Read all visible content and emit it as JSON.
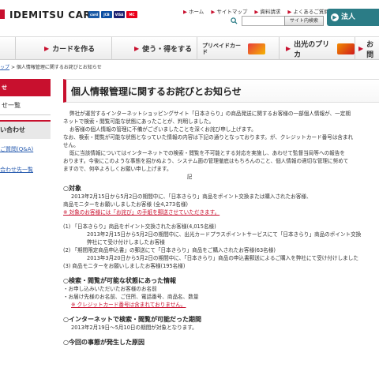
{
  "header": {
    "logo_text": "IDEMITSU CARD",
    "cards": [
      {
        "label": "card",
        "color": "#1a5aa6"
      },
      {
        "label": "JCB",
        "color": "#0b4ea2"
      },
      {
        "label": "VISA",
        "color": "#1a1f71"
      },
      {
        "label": "MC",
        "color": "#eb001b"
      }
    ],
    "top_links": [
      "ホーム",
      "サイトマップ",
      "資料請求",
      "よくあるご質問(Q&A)"
    ],
    "search_button": "サイト内検索",
    "corp_button": "法人"
  },
  "nav": {
    "items": [
      {
        "label": "カードを作る"
      },
      {
        "label": "使う・得をする"
      },
      {
        "label": "プリペイドカード"
      },
      {
        "label": "出光のプリカ"
      },
      {
        "label": "お問"
      }
    ]
  },
  "breadcrumb": {
    "home": "ップ",
    "sep": ">",
    "current": "個人情報管理に関するお詫びとお知らせ"
  },
  "sidebar": {
    "head1": "せ",
    "item1": "せ一覧",
    "head2": "い合わせ",
    "link1": "ご質問(Q&A)",
    "link2": "合わせ先一覧"
  },
  "main": {
    "title": "個人情報管理に関するお詫びとお知らせ",
    "intro": [
      "弊社が運営するインターネットショッピングサイト「日本きらり」の商品発送に関するお客様の一部個人情報が、一定期",
      "ネットで検索・閲覧可能な状態にあったことが、判明しました。",
      "お客様の個人情報の管理に不備がございましたことを深くお詫び申し上げます。",
      "なお、検索・閲覧が可能な状態となっていた情報の内容は下記の通りとなっております。が、クレジットカード番号は含まれ",
      "せん。",
      "既に当該情報についてはインターネットでの検索・閲覧を不可能とする対応を実施し、あわせて監督当局等への報告を",
      "おります。今後にこのような事態を招かぬよう、システム面の管理徹底はもちろんのこと、個人情報の適切な管理に努めて",
      "ますので、何卒よろしくお願い申し上げます。",
      "記"
    ],
    "sec1_title": "○対象",
    "sec1_lines": [
      "2013年2月15日から5月2日の期間中に、「日本きらり」商品をポイント交換または購入されたお客様、",
      "商品モニターをお願いしましたお客様 (全4,273名様)"
    ],
    "sec1_note": "※ 対象のお客様には「お詫び」の手紙を郵送させていただきます。",
    "sec1_sub": [
      "(1) 「日本きらり」商品をポイント交換されたお客様(4,015名様)",
      "2013年2月15日から5月2日の期間中に、出光カードプラスポイントサービスにて「日本きらり」商品のポイント交換",
      "弊社にて受け付けしましたお客様",
      "(2) 「期間限定商品申込書」の郵送にて「日本きらり」商品をご購入されたお客様(63名様)",
      "2013年3月20日から5月2日の期間中に、「日本きらり」商品の申込書郵送によるご購入を弊社にて受け付けしました",
      "(3) 商品モニターをお願いしましたお客様(195名様)"
    ],
    "sec2_title": "○検索・閲覧が可能な状態にあった情報",
    "sec2_lines": [
      "・お申し込みいただいたお客様のお名前",
      "・お届け先様のお名前、ご住所、電話番号、商品名、数量"
    ],
    "sec2_note": "※ クレジットカード番号は含まれておりません。",
    "sec3_title": "○インターネットで検索・閲覧が可能だった期間",
    "sec3_line": "2013年2月19日～5月10日の期間が対象となります。",
    "sec4_title": "○今回の事態が発生した原因"
  }
}
